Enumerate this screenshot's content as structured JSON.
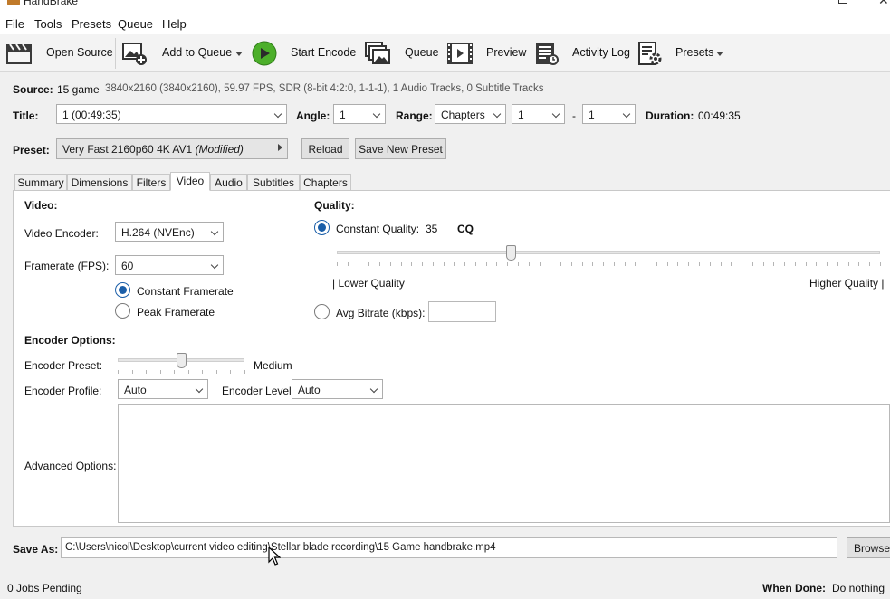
{
  "window": {
    "title": "HandBrake"
  },
  "menu": [
    "File",
    "Tools",
    "Presets",
    "Queue",
    "Help"
  ],
  "toolbar": {
    "open_source": "Open Source",
    "add_to_queue": "Add to Queue",
    "start_encode": "Start Encode",
    "queue": "Queue",
    "preview": "Preview",
    "activity_log": "Activity Log",
    "presets": "Presets"
  },
  "source": {
    "label": "Source:",
    "name": "15 game",
    "info": "3840x2160 (3840x2160), 59.97 FPS, SDR (8-bit 4:2:0, 1-1-1), 1 Audio Tracks, 0 Subtitle Tracks"
  },
  "title_row": {
    "title_label": "Title:",
    "title_value": "1  (00:49:35)",
    "angle_label": "Angle:",
    "angle_value": "1",
    "range_label": "Range:",
    "range_type": "Chapters",
    "range_start": "1",
    "range_dash": "-",
    "range_end": "1",
    "duration_label": "Duration:",
    "duration_value": "00:49:35"
  },
  "preset_row": {
    "label": "Preset:",
    "value": "Very Fast 2160p60 4K AV1",
    "modified": "(Modified)",
    "reload": "Reload",
    "save_new": "Save New Preset"
  },
  "tabs": [
    "Summary",
    "Dimensions",
    "Filters",
    "Video",
    "Audio",
    "Subtitles",
    "Chapters"
  ],
  "active_tab": "Video",
  "video": {
    "section": "Video:",
    "encoder_label": "Video Encoder:",
    "encoder_value": "H.264 (NVEnc)",
    "framerate_label": "Framerate (FPS):",
    "framerate_value": "60",
    "constant_framerate": "Constant Framerate",
    "peak_framerate": "Peak Framerate"
  },
  "quality": {
    "section": "Quality:",
    "constant_quality_label": "Constant Quality:",
    "cq_value": "35",
    "cq_unit": "CQ",
    "lower": "| Lower Quality",
    "higher": "Higher Quality |",
    "avg_bitrate_label": "Avg Bitrate (kbps):",
    "avg_bitrate_value": "",
    "slider_fraction": 0.32
  },
  "encoder_options": {
    "section": "Encoder Options:",
    "preset_label": "Encoder Preset:",
    "preset_value": "Medium",
    "preset_slider_fraction": 0.5,
    "profile_label": "Encoder Profile:",
    "profile_value": "Auto",
    "level_label": "Encoder Level:",
    "level_value": "Auto",
    "advanced_label": "Advanced Options:",
    "advanced_value": ""
  },
  "save_as": {
    "label": "Save As:",
    "path": "C:\\Users\\nicol\\Desktop\\current video editing\\Stellar blade recording\\15 Game handbrake.mp4",
    "browse": "Browse"
  },
  "status": {
    "jobs": "0 Jobs Pending",
    "when_done_label": "When Done:",
    "when_done_value": "Do nothing"
  },
  "colors": {
    "accent": "#1a5ea8",
    "start_green": "#4caf2a"
  }
}
